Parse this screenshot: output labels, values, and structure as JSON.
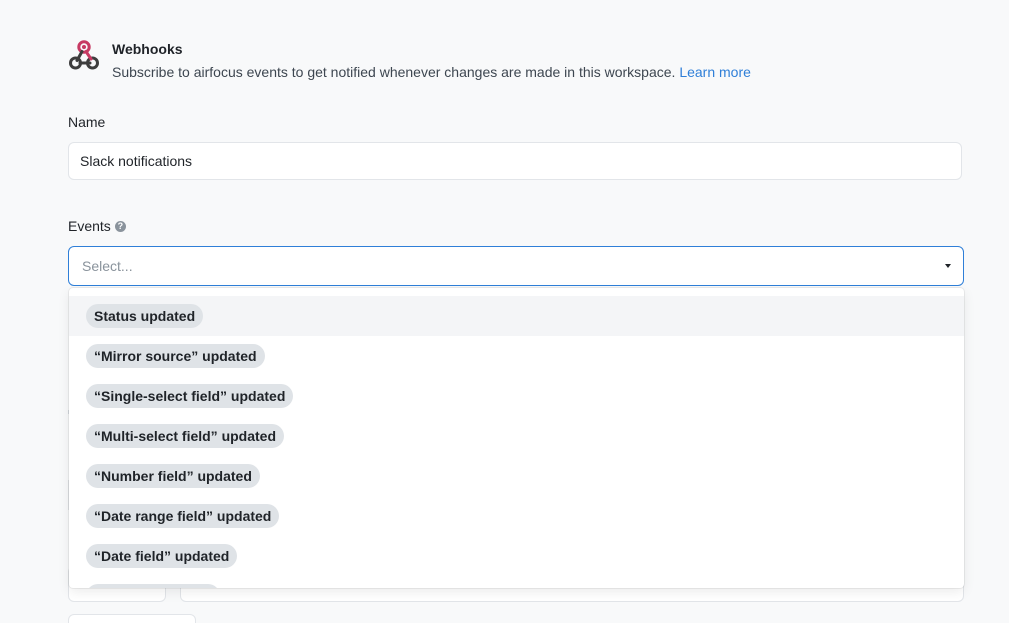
{
  "header": {
    "title": "Webhooks",
    "description": "Subscribe to airfocus events to get notified whenever changes are made in this workspace.",
    "learn_more": "Learn more",
    "icon": "webhook-icon"
  },
  "name_field": {
    "label": "Name",
    "value": "Slack notifications"
  },
  "events_field": {
    "label": "Events",
    "help_icon": "question-circle-icon",
    "placeholder": "Select...",
    "options": [
      "Status updated",
      "“Mirror source” updated",
      "“Single-select field” updated",
      "“Multi-select field” updated",
      "“Number field” updated",
      "“Date range field” updated",
      "“Date field” updated"
    ]
  },
  "colors": {
    "accent": "#2f7fd8",
    "chip_bg": "#dfe3e7",
    "webhook_red": "#c73a63",
    "webhook_dark": "#3d3d3d"
  }
}
